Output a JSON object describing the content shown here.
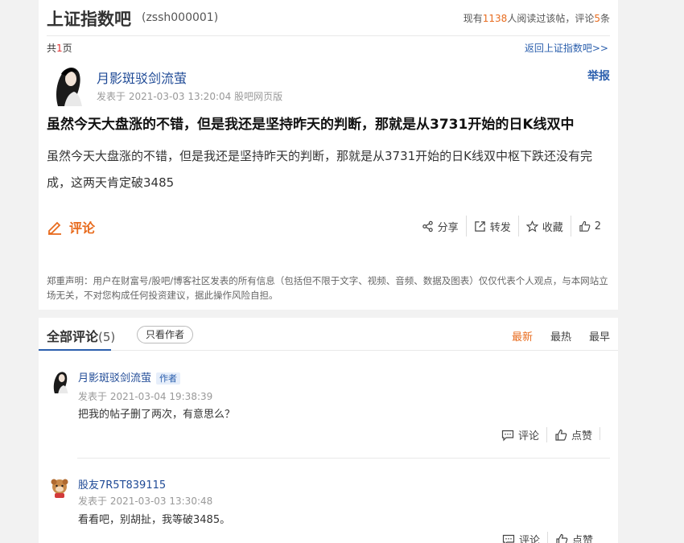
{
  "bar": {
    "title": "上证指数吧",
    "code": "(zssh000001)",
    "stats_prefix": "现有",
    "readers": "1138",
    "stats_mid": "人阅读过该帖，评论",
    "comment_count": "5",
    "stats_suffix": "条"
  },
  "pagination": {
    "prefix": "共",
    "total": "1",
    "suffix": "页"
  },
  "back_link": "返回上证指数吧>>",
  "post": {
    "author": "月影斑驳剑流萤",
    "report": "举报",
    "meta": "发表于 2021-03-03 13:20:04 股吧网页版",
    "title": "虽然今天大盘涨的不错，但是我还是坚持昨天的判断，那就是从3731开始的日K线双中",
    "body": "虽然今天大盘涨的不错，但是我还是坚持昨天的判断，那就是从3731开始的日K线双中枢下跌还没有完成，这两天肯定破3485",
    "comment_label": "评论",
    "actions": {
      "share": "分享",
      "forward": "转发",
      "favorite": "收藏",
      "like_count": "2"
    },
    "disclaimer": "郑重声明：用户在财富号/股吧/博客社区发表的所有信息（包括但不限于文字、视频、音频、数据及图表）仅仅代表个人观点，与本网站立场无关，不对您构成任何投资建议，据此操作风险自担。"
  },
  "comments_section": {
    "title": "全部评论",
    "count": "(5)",
    "only_author": "只看作者",
    "sorts": [
      "最新",
      "最热",
      "最早"
    ]
  },
  "comments": [
    {
      "name": "月影斑驳剑流萤",
      "badge": "作者",
      "meta": "发表于 2021-03-04 19:38:39",
      "text": "把我的帖子删了两次，有意思么？",
      "reply": "评论",
      "like": "点赞"
    },
    {
      "name": "股友7R5T839115",
      "meta": "发表于 2021-03-03 13:30:48",
      "text": "看看吧，别胡扯，我等破3485。",
      "reply": "评论",
      "like": "点赞"
    }
  ],
  "colors": {
    "accent": "#e86c1f",
    "link": "#1f4a96",
    "background": "#f2f2f2"
  }
}
